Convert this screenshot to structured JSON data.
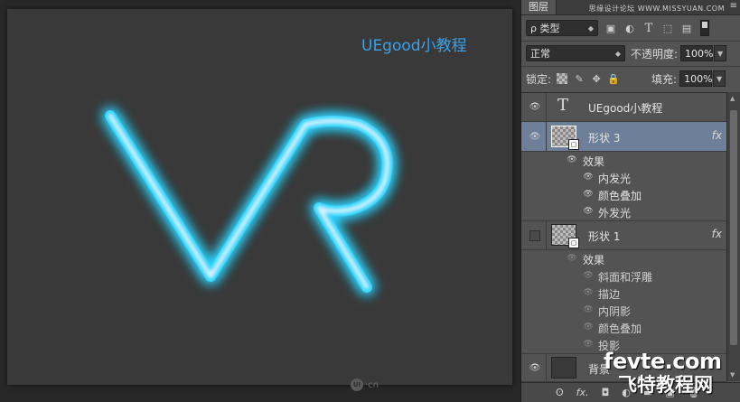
{
  "canvas": {
    "title_text": "UEgood小教程",
    "vr_glow_color": "#2ad4ff",
    "vr_core_color": "#e8f4ff",
    "watermark": {
      "logo": "UI",
      "text": "·cn"
    }
  },
  "panel": {
    "tab_label": "图层",
    "site_watermark": "思缘设计论坛 WWW.MISSYUAN.COM",
    "filter": {
      "label": "ρ 类型"
    },
    "blend_mode": "正常",
    "opacity_label": "不透明度:",
    "opacity_value": "100%",
    "lock_label": "锁定:",
    "fill_label": "填充:",
    "fill_value": "100%"
  },
  "layers": [
    {
      "name": "UEgood小教程",
      "type": "text",
      "visible": true,
      "thumb_glyph": "T"
    },
    {
      "name": "形状 3",
      "type": "shape",
      "visible": true,
      "selected": true,
      "fx": "fx",
      "effects_label": "效果",
      "effects": [
        "内发光",
        "颜色叠加",
        "外发光"
      ]
    },
    {
      "name": "形状 1",
      "type": "shape",
      "visible": false,
      "fx": "fx",
      "effects_label": "效果",
      "effects": [
        "斜面和浮雕",
        "描边",
        "内阴影",
        "颜色叠加",
        "投影"
      ]
    },
    {
      "name": "背景",
      "type": "background",
      "visible": true
    }
  ],
  "bottom_bar": {
    "link": "ʘ",
    "fx": "fx.",
    "mask": "◘",
    "adjust": "◐",
    "group": "▬",
    "new": "▣",
    "delete": "🗑"
  },
  "site_watermark": {
    "big": "fevte.com",
    "cn": "飞特教程网"
  }
}
